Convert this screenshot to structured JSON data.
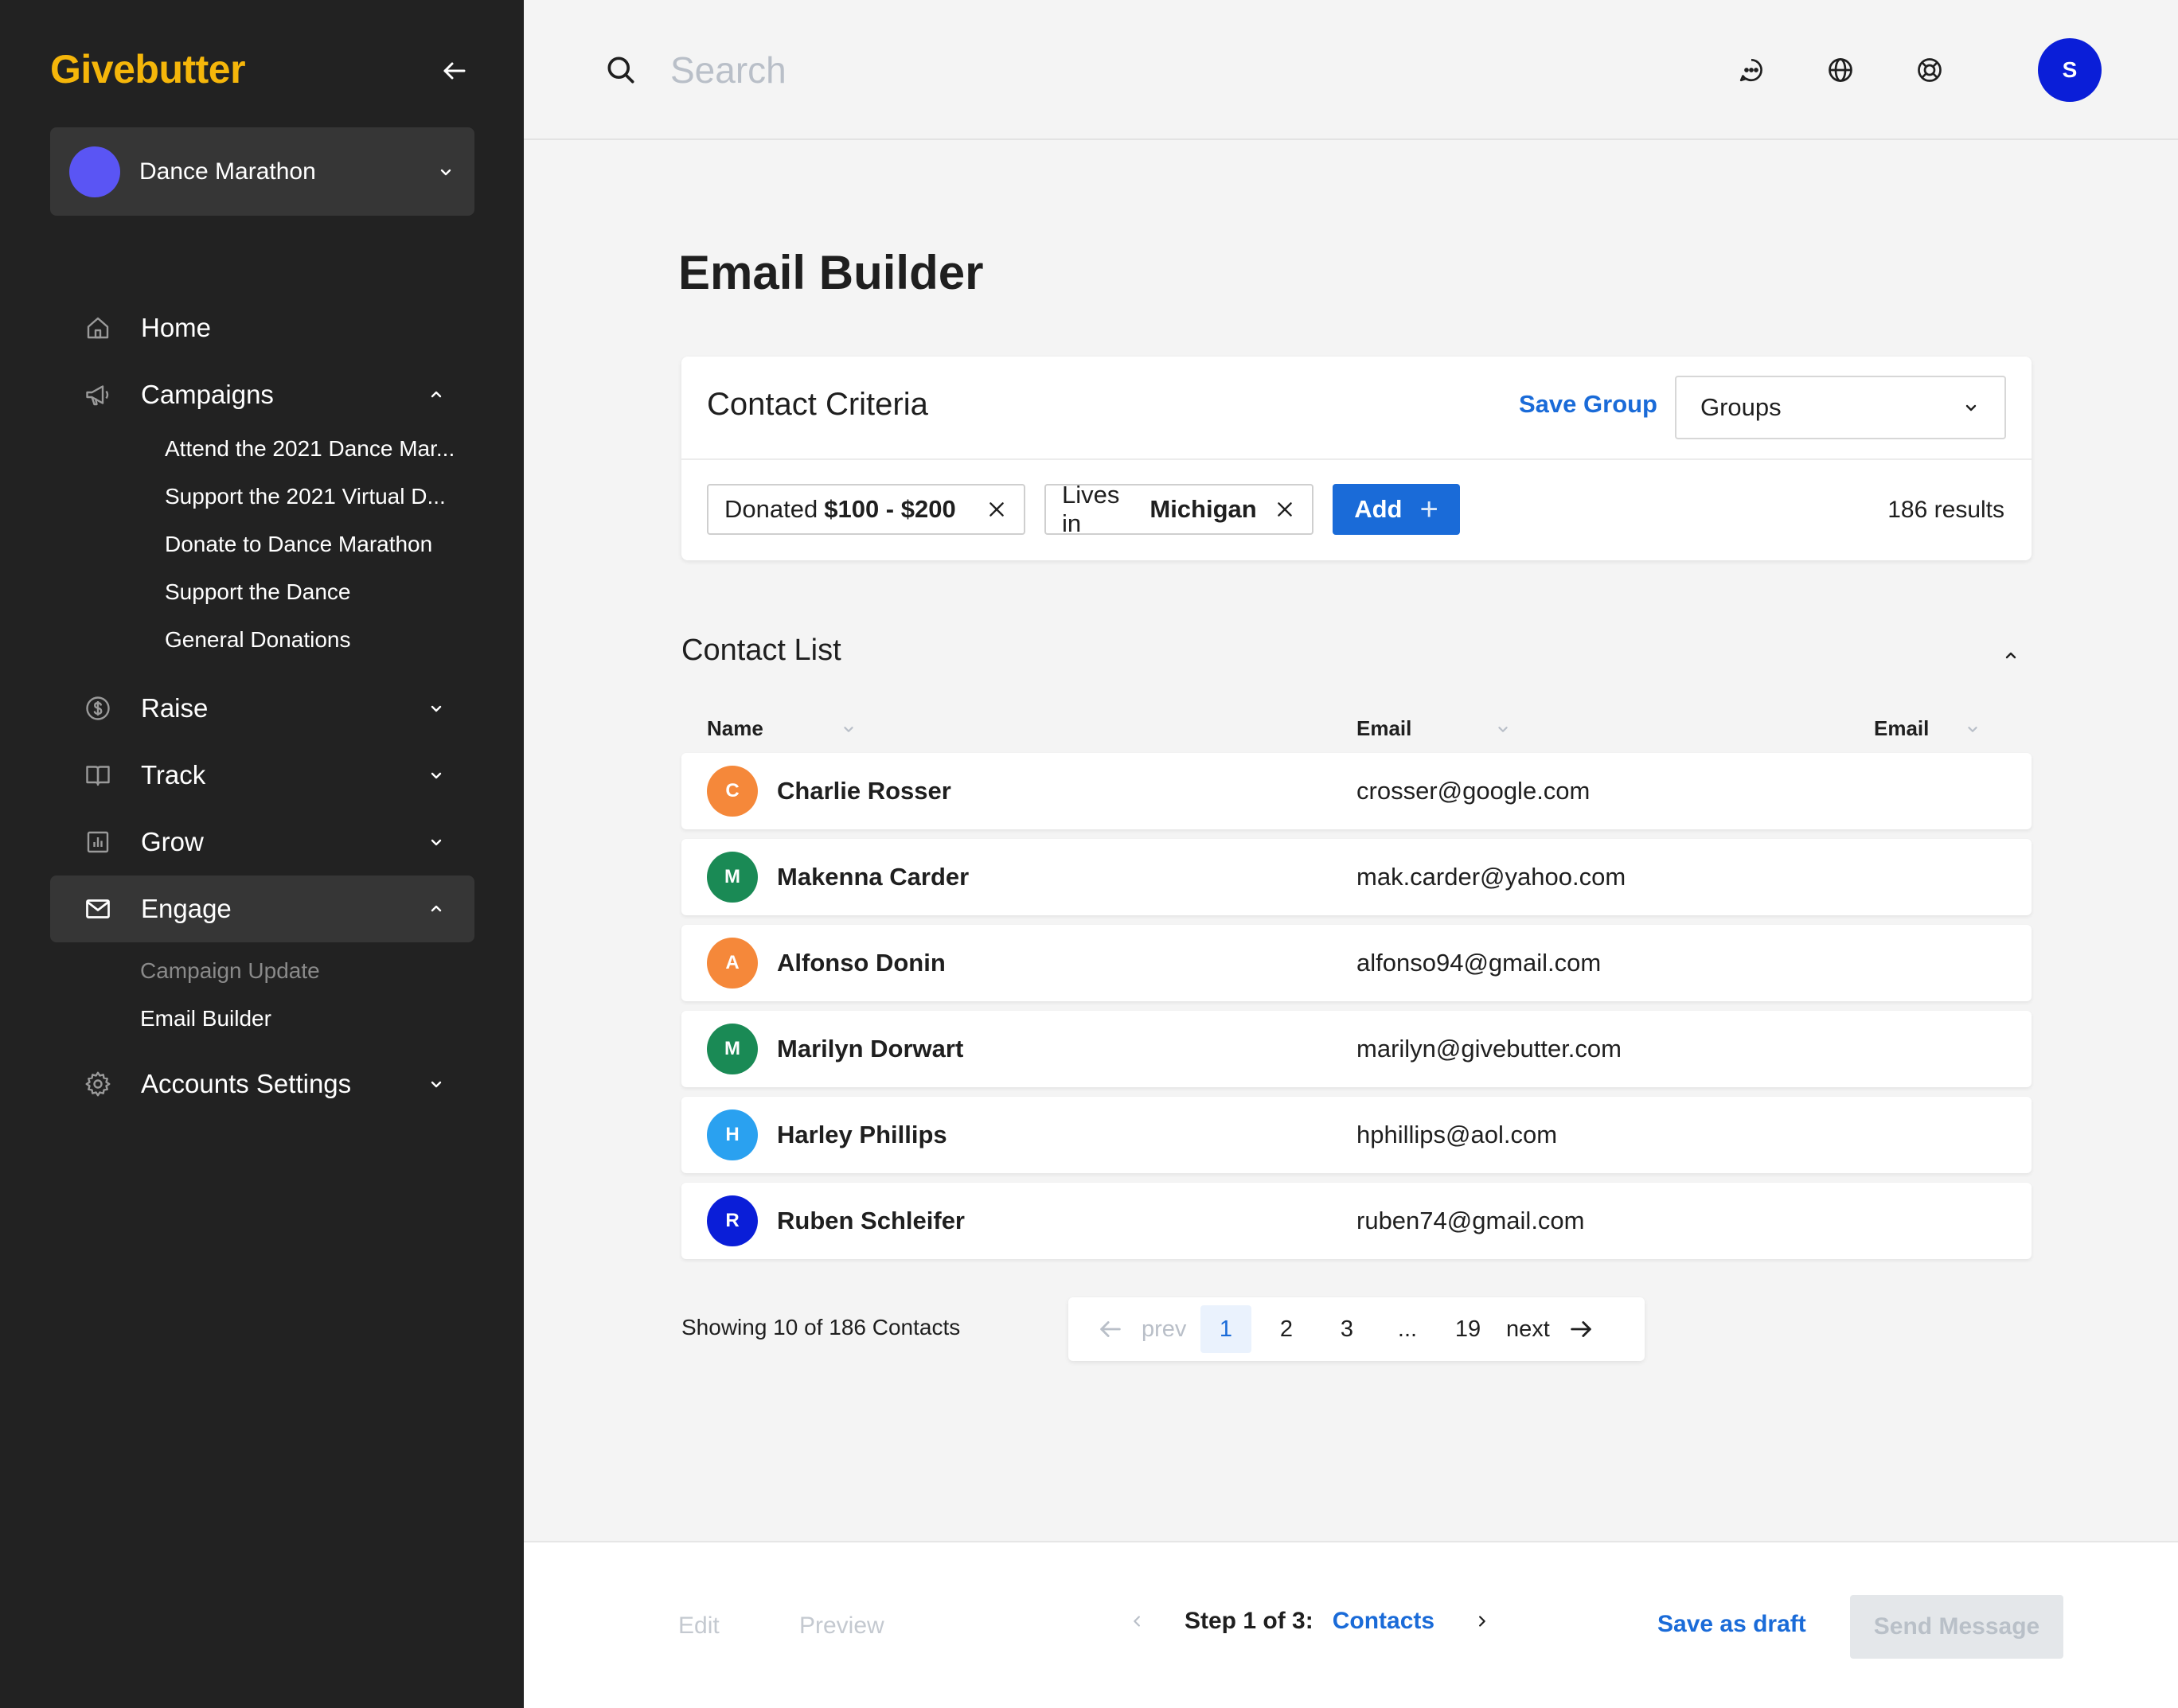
{
  "sidebar": {
    "logo": "Givebutter",
    "org": {
      "name": "Dance Marathon",
      "avatar_color": "#5a55f4"
    },
    "nav": {
      "home": "Home",
      "campaigns": "Campaigns",
      "campaign_items": [
        {
          "label": "Attend the 2021 Dance Mar...",
          "dot_color": "#27ae60"
        },
        {
          "label": "Support the 2021 Virtual D...",
          "dot_color": "#27ae60"
        },
        {
          "label": "Donate to Dance Marathon",
          "dot_color": "#27ae60"
        },
        {
          "label": "Support the Dance",
          "dot_color": "#27ae60"
        },
        {
          "label": "General Donations",
          "dot_color": "#2f6fe0"
        }
      ],
      "raise": "Raise",
      "track": "Track",
      "grow": "Grow",
      "engage": "Engage",
      "engage_items": [
        "Campaign Update",
        "Email Builder"
      ],
      "settings": "Accounts Settings"
    }
  },
  "topbar": {
    "search_placeholder": "Search",
    "user_initial": "S",
    "icons": [
      "chat-icon",
      "globe-icon",
      "help-icon"
    ]
  },
  "page": {
    "title": "Email Builder"
  },
  "criteria": {
    "title": "Contact Criteria",
    "save_group": "Save Group",
    "groups_select": "Groups",
    "chips": [
      {
        "prefix": "Donated",
        "value": "$100 - $200"
      },
      {
        "prefix": "Lives in",
        "value": "Michigan"
      }
    ],
    "add_label": "Add",
    "results": "186 results"
  },
  "contact_list": {
    "title": "Contact List",
    "columns": [
      "Name",
      "Email",
      "Email"
    ],
    "rows": [
      {
        "initial": "C",
        "name": "Charlie Rosser",
        "email": "crosser@google.com",
        "color": "#f5883a"
      },
      {
        "initial": "M",
        "name": "Makenna Carder",
        "email": "mak.carder@yahoo.com",
        "color": "#1a8a55"
      },
      {
        "initial": "A",
        "name": "Alfonso Donin",
        "email": "alfonso94@gmail.com",
        "color": "#f5883a"
      },
      {
        "initial": "M",
        "name": "Marilyn Dorwart",
        "email": "marilyn@givebutter.com",
        "color": "#1a8a55"
      },
      {
        "initial": "H",
        "name": "Harley Phillips",
        "email": "hphillips@aol.com",
        "color": "#2aa1f0"
      },
      {
        "initial": "R",
        "name": "Ruben Schleifer",
        "email": "ruben74@gmail.com",
        "color": "#0a1ed8"
      }
    ],
    "showing": "Showing 10 of 186 Contacts",
    "pagination": {
      "prev": "prev",
      "pages": [
        "1",
        "2",
        "3",
        "...",
        "19"
      ],
      "current": "1",
      "next": "next"
    }
  },
  "footer": {
    "edit": "Edit",
    "preview": "Preview",
    "step_text": "Step 1 of 3:",
    "step_current": "Contacts",
    "save_draft": "Save as draft",
    "send": "Send Message"
  },
  "colors": {
    "accent": "#1a6bd8",
    "brand_yellow": "#f5b60a",
    "sidebar_bg": "#222222"
  }
}
